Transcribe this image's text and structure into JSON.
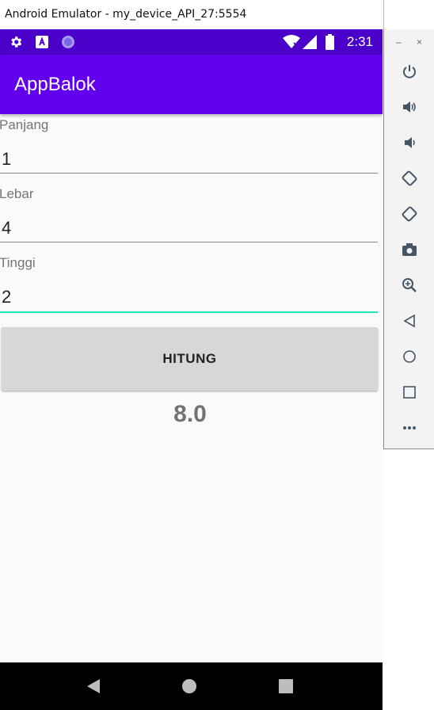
{
  "window": {
    "title": "Android Emulator - my_device_API_27:5554"
  },
  "statusbar": {
    "time": "2:31",
    "left_icons": [
      "settings-icon",
      "a-letter-icon",
      "circle-icon"
    ],
    "right_icons": [
      "wifi-icon",
      "signal-icon",
      "battery-icon"
    ]
  },
  "appbar": {
    "title": "AppBalok",
    "color": "#6200ee",
    "status_color": "#4a00c8"
  },
  "form": {
    "panjang": {
      "label": "Panjang",
      "value": "1"
    },
    "lebar": {
      "label": "Lebar",
      "value": "4"
    },
    "tinggi": {
      "label": "Tinggi",
      "value": "2",
      "focused": true
    }
  },
  "button": {
    "label": "HITUNG"
  },
  "result": {
    "value": "8.0"
  },
  "navbar": {
    "buttons": [
      "back-icon",
      "home-icon",
      "recents-icon"
    ]
  },
  "emulator_sidebar": {
    "window_controls": [
      "–",
      "×"
    ],
    "buttons": [
      "power-icon",
      "volume-up-icon",
      "volume-down-icon",
      "rotate-left-icon",
      "rotate-right-icon",
      "camera-icon",
      "zoom-icon",
      "back-icon",
      "home-icon",
      "overview-icon",
      "more-icon"
    ]
  }
}
